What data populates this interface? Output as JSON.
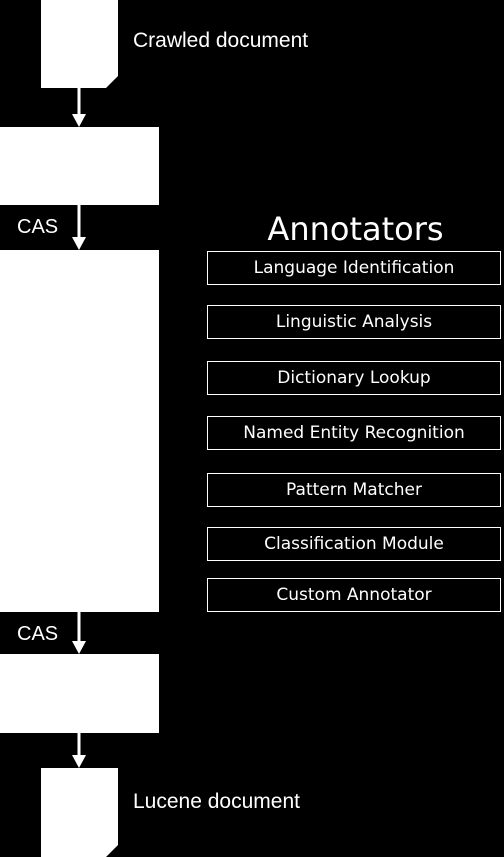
{
  "diagram": {
    "input_doc_label": "Crawled document",
    "output_doc_label": "Lucene document",
    "cas_label_1": "CAS",
    "cas_label_2": "CAS",
    "annotators_title": "Annotators",
    "annotators": [
      "Language Identification",
      "Linguistic Analysis",
      "Dictionary Lookup",
      "Named Entity Recognition",
      "Pattern Matcher",
      "Classification Module",
      "Custom Annotator"
    ]
  }
}
